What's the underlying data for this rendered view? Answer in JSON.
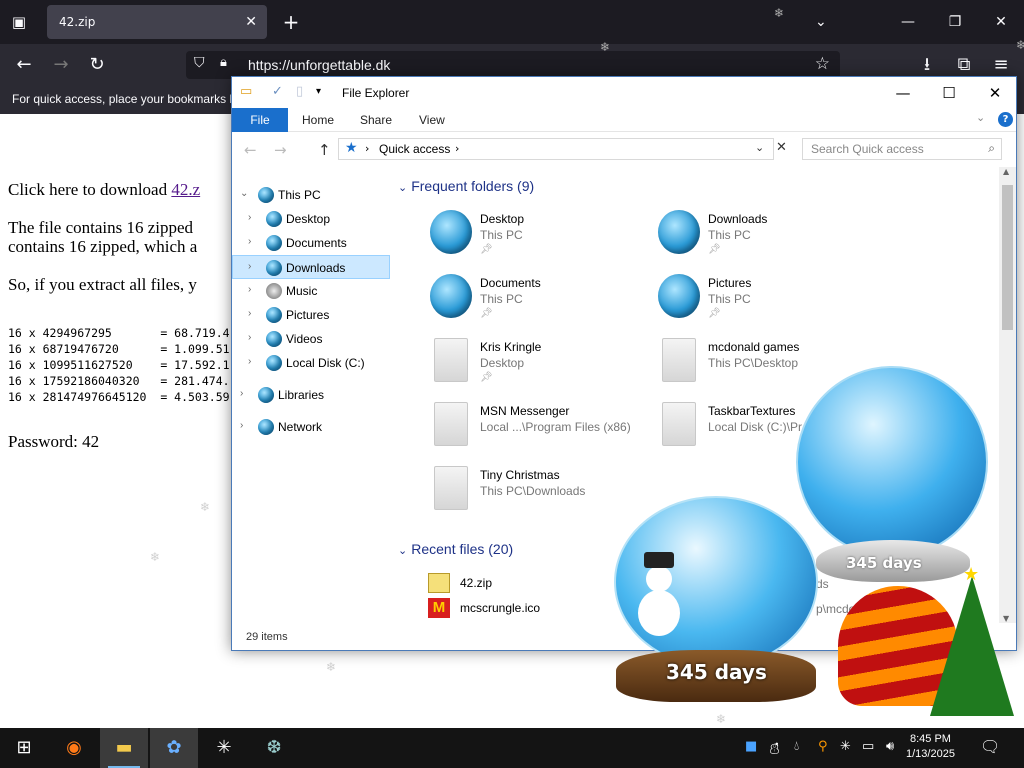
{
  "browser": {
    "tab_title": "42.zip",
    "tab_close": "✕",
    "new_tab": "+",
    "url": "https://unforgettable.dk",
    "bookmarks_hint": "For quick access, place your bookmarks h"
  },
  "webpage": {
    "download_prefix": "Click here to download ",
    "download_link": "42.z",
    "line1": "The file contains 16 zipped",
    "line2": "contains 16 zipped, which a",
    "line3": "So, if you extract all files, y",
    "table": [
      "16 x 4294967295       = 68.719.4",
      "16 x 68719476720      = 1.099.51",
      "16 x 1099511627520    = 17.592.1",
      "16 x 17592186040320   = 281.474.",
      "16 x 281474976645120  = 4.503.59"
    ],
    "password": "Password: 42"
  },
  "explorer": {
    "title": "File Explorer",
    "ribbon": {
      "file": "File",
      "home": "Home",
      "share": "Share",
      "view": "View"
    },
    "address": "Quick access",
    "search_placeholder": "Search Quick access",
    "nav": {
      "this_pc": "This PC",
      "desktop": "Desktop",
      "documents": "Documents",
      "downloads": "Downloads",
      "music": "Music",
      "pictures": "Pictures",
      "videos": "Videos",
      "local_disk": "Local Disk (C:)",
      "libraries": "Libraries",
      "network": "Network"
    },
    "frequent_header": "Frequent folders (9)",
    "frequent": [
      {
        "name": "Desktop",
        "path": "This PC"
      },
      {
        "name": "Downloads",
        "path": "This PC"
      },
      {
        "name": "Documents",
        "path": "This PC"
      },
      {
        "name": "Pictures",
        "path": "This PC"
      },
      {
        "name": "Kris Kringle",
        "path": "Desktop"
      },
      {
        "name": "mcdonald games",
        "path": "This PC\\Desktop"
      },
      {
        "name": "MSN Messenger",
        "path": "Local ...\\Program Files (x86)"
      },
      {
        "name": "TaskbarTextures",
        "path": "Local Disk (C:)\\Pr..."
      },
      {
        "name": "Tiny Christmas",
        "path": "This PC\\Downloads"
      }
    ],
    "recent_header": "Recent files (20)",
    "recent": [
      {
        "name": "42.zip"
      },
      {
        "name": "mcscrungle.ico"
      }
    ],
    "recent_path_partial_1": "ds",
    "recent_path_partial_2": "p\\mcdo",
    "status": "29 items"
  },
  "decorations": {
    "globe_text": "345 days"
  },
  "taskbar": {
    "time": "8:45 PM",
    "date": "1/13/2025"
  },
  "colors": {
    "accent": "#1a6fcc",
    "browser_bg": "#1c1b22",
    "selected": "#cce8ff",
    "group_header": "#1e3287"
  }
}
